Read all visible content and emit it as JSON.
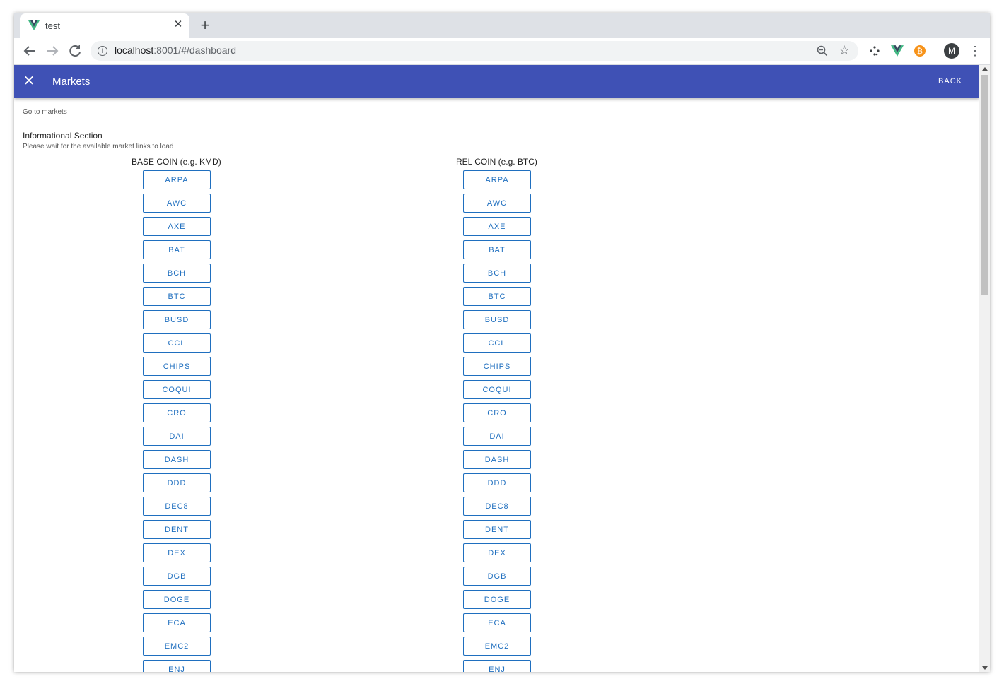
{
  "browser": {
    "tab_title": "test",
    "url_host": "localhost",
    "url_rest": ":8001/#/dashboard",
    "avatar_letter": "M",
    "accent_vue": "#41b883",
    "accent_ext": "#f7931a"
  },
  "appbar": {
    "title": "Markets",
    "back_label": "BACK",
    "color": "#3f51b5"
  },
  "page": {
    "link_text": "Go to markets",
    "info_title": "Informational Section",
    "info_subtitle": "Please wait for the available market links to load",
    "base_header": "BASE COIN (e.g. KMD)",
    "rel_header": "REL COIN (e.g. BTC)",
    "coins": [
      "ARPA",
      "AWC",
      "AXE",
      "BAT",
      "BCH",
      "BTC",
      "BUSD",
      "CCL",
      "CHIPS",
      "COQUI",
      "CRO",
      "DAI",
      "DASH",
      "DDD",
      "DEC8",
      "DENT",
      "DEX",
      "DGB",
      "DOGE",
      "ECA",
      "EMC2",
      "ENJ"
    ]
  }
}
